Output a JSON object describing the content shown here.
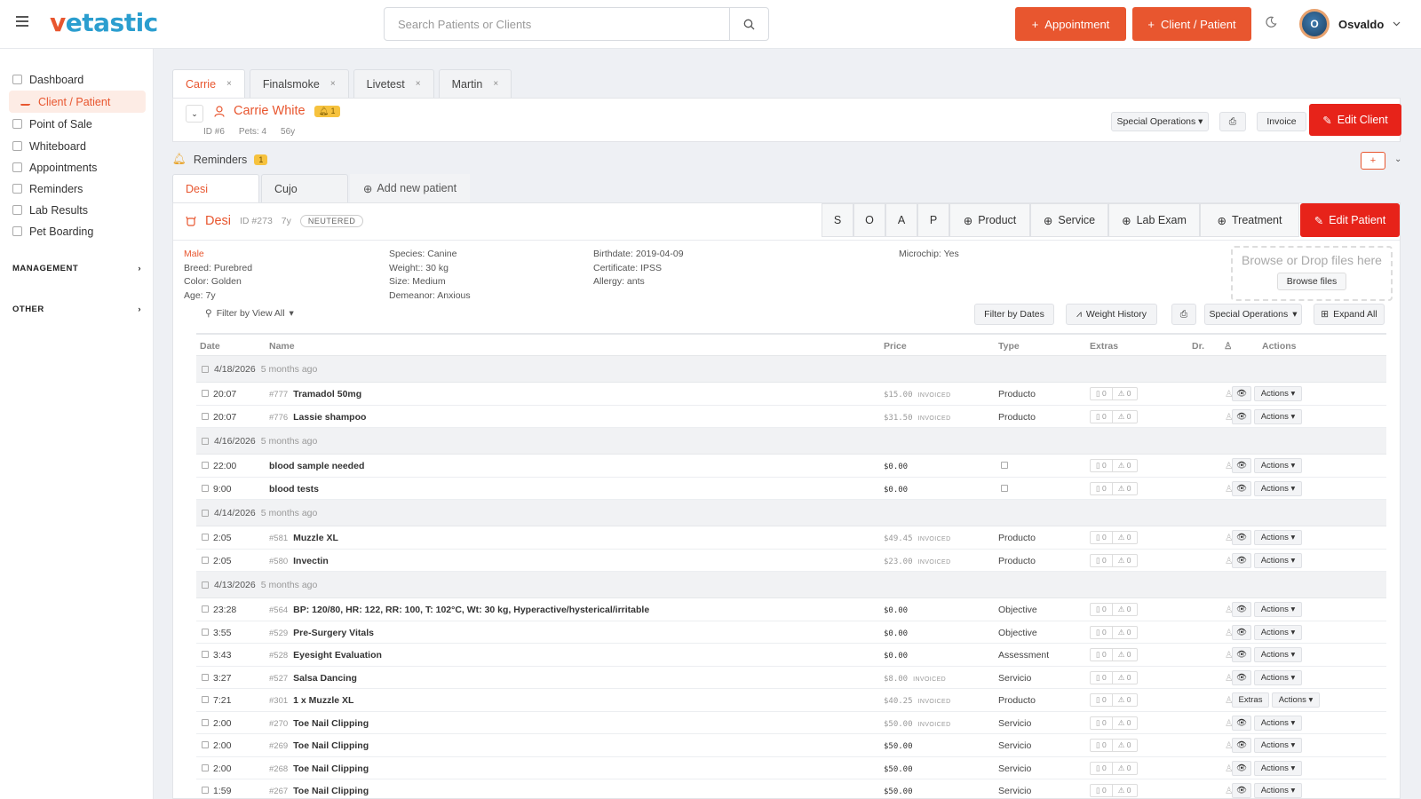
{
  "app": {
    "logo_v": "v",
    "logo_rest": "etastic"
  },
  "search": {
    "placeholder": "Search Patients or Clients"
  },
  "header": {
    "appointment_label": "Appointment",
    "client_patient_label": "Client / Patient",
    "user_initial": "O",
    "user_name": "Osvaldo"
  },
  "sidebar": {
    "items": [
      {
        "label": "Dashboard"
      },
      {
        "label": "Client / Patient"
      },
      {
        "label": "Point of Sale"
      },
      {
        "label": "Whiteboard"
      },
      {
        "label": "Appointments"
      },
      {
        "label": "Reminders"
      },
      {
        "label": "Lab Results"
      },
      {
        "label": "Pet Boarding"
      }
    ],
    "sections": [
      {
        "label": "MANAGEMENT"
      },
      {
        "label": "OTHER"
      }
    ]
  },
  "client_tabs": [
    {
      "label": "Carrie"
    },
    {
      "label": "Finalsmoke"
    },
    {
      "label": "Livetest"
    },
    {
      "label": "Martin"
    }
  ],
  "client": {
    "name": "Carrie White",
    "alert_count": "1",
    "id": "ID #6",
    "pets": "Pets: 4",
    "age": "56y",
    "special_ops": "Special Operations",
    "invoice": "Invoice",
    "edit": "Edit Client"
  },
  "reminders": {
    "label": "Reminders",
    "count": "1"
  },
  "patient_tabs": [
    {
      "label": "Desi"
    },
    {
      "label": "Cujo"
    }
  ],
  "add_patient": "Add new patient",
  "patient": {
    "name": "Desi",
    "id": "ID #273",
    "age": "7y",
    "status": "NEUTERED",
    "soap": [
      "S",
      "O",
      "A",
      "P"
    ],
    "add_buttons": [
      "Product",
      "Service",
      "Lab Exam",
      "Treatment"
    ],
    "edit": "Edit Patient",
    "info_col1": [
      "Male",
      "Breed: Purebred",
      "Color: Golden",
      "Age: 7y"
    ],
    "info_col2": [
      "Species: Canine",
      "Weight:: 30 kg",
      "Size: Medium",
      "Demeanor: Anxious"
    ],
    "info_col3": [
      "Birthdate: 2019-04-09",
      "Certificate: IPSS",
      "Allergy: ants"
    ],
    "info_col4": [
      "Microchip: Yes"
    ],
    "drop_text": "Browse or Drop files here",
    "browse": "Browse files"
  },
  "toolbar": {
    "filter": "Filter by View All",
    "filter_dates": "Filter by Dates",
    "weight_history": "Weight History",
    "special_ops": "Special Operations",
    "expand_all": "Expand All"
  },
  "table": {
    "headers": [
      "Date",
      "Name",
      "Price",
      "Type",
      "Extras",
      "Dr.",
      "Actions"
    ],
    "actions_label": "Actions",
    "extras_label": "Extras",
    "invoiced": "INVOICED",
    "groups": [
      {
        "date": "4/18/2026",
        "ago": "5 months ago",
        "rows": [
          {
            "time": "20:07",
            "num": "#777",
            "name": "Tramadol 50mg",
            "price": "$15.00",
            "invoiced": true,
            "type": "Producto"
          },
          {
            "time": "20:07",
            "num": "#776",
            "name": "Lassie shampoo",
            "price": "$31.50",
            "invoiced": true,
            "type": "Producto"
          }
        ]
      },
      {
        "date": "4/16/2026",
        "ago": "5 months ago",
        "rows": [
          {
            "time": "22:00",
            "num": "",
            "name": "blood sample needed",
            "price": "$0.00",
            "invoiced": false,
            "type": ""
          },
          {
            "time": "9:00",
            "num": "",
            "name": "blood tests",
            "price": "$0.00",
            "invoiced": false,
            "type": ""
          }
        ]
      },
      {
        "date": "4/14/2026",
        "ago": "5 months ago",
        "rows": [
          {
            "time": "2:05",
            "num": "#581",
            "name": "Muzzle XL",
            "price": "$49.45",
            "invoiced": true,
            "type": "Producto"
          },
          {
            "time": "2:05",
            "num": "#580",
            "name": "Invectin",
            "price": "$23.00",
            "invoiced": true,
            "type": "Producto"
          }
        ]
      },
      {
        "date": "4/13/2026",
        "ago": "5 months ago",
        "rows": [
          {
            "time": "23:28",
            "num": "#564",
            "name": "BP: 120/80, HR: 122, RR: 100, T: 102°C, Wt: 30 kg, Hyperactive/hysterical/irritable",
            "price": "$0.00",
            "invoiced": false,
            "type": "Objective"
          },
          {
            "time": "3:55",
            "num": "#529",
            "name": "Pre-Surgery Vitals",
            "price": "$0.00",
            "invoiced": false,
            "type": "Objective"
          },
          {
            "time": "3:43",
            "num": "#528",
            "name": "Eyesight Evaluation",
            "price": "$0.00",
            "invoiced": false,
            "type": "Assessment"
          },
          {
            "time": "3:27",
            "num": "#527",
            "name": "Salsa Dancing",
            "price": "$8.00",
            "invoiced": true,
            "type": "Servicio"
          },
          {
            "time": "7:21",
            "num": "#301",
            "name": "1 x Muzzle XL",
            "price": "$40.25",
            "invoiced": true,
            "type": "Producto",
            "extras_btn": true
          },
          {
            "time": "2:00",
            "num": "#270",
            "name": "Toe Nail Clipping",
            "price": "$50.00",
            "invoiced": true,
            "type": "Servicio"
          },
          {
            "time": "2:00",
            "num": "#269",
            "name": "Toe Nail Clipping",
            "price": "$50.00",
            "invoiced": false,
            "type": "Servicio"
          },
          {
            "time": "2:00",
            "num": "#268",
            "name": "Toe Nail Clipping",
            "price": "$50.00",
            "invoiced": false,
            "type": "Servicio"
          },
          {
            "time": "1:59",
            "num": "#267",
            "name": "Toe Nail Clipping",
            "price": "$50.00",
            "invoiced": false,
            "type": "Servicio"
          }
        ]
      }
    ]
  },
  "colors": {
    "accent": "#e8562f",
    "danger": "#e7231a",
    "brand_blue": "#2b9ecf",
    "warning": "#f6c23e"
  }
}
